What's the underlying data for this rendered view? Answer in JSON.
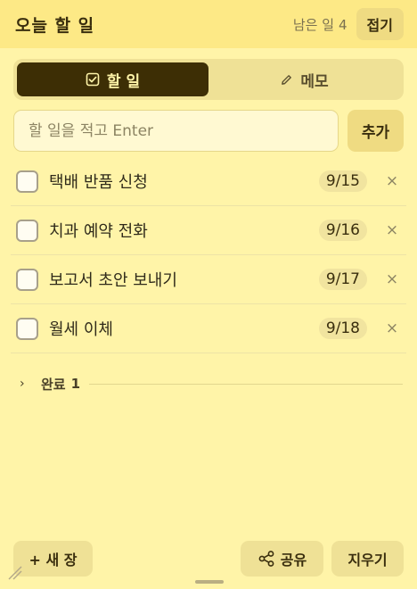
{
  "header": {
    "title": "오늘 할 일",
    "remaining_label": "남은 일",
    "remaining_count": "4",
    "collapse_label": "접기"
  },
  "tabs": [
    {
      "label": "할 일",
      "icon": "checkbox-icon",
      "active": true
    },
    {
      "label": "메모",
      "icon": "pencil-icon",
      "active": false
    }
  ],
  "input": {
    "placeholder": "할 일을 적고 Enter",
    "value": "",
    "add_label": "추가"
  },
  "tasks": [
    {
      "text": "택배 반품 신청",
      "date": "9/15",
      "done": false
    },
    {
      "text": "치과 예약 전화",
      "date": "9/16",
      "done": false
    },
    {
      "text": "보고서 초안 보내기",
      "date": "9/17",
      "done": false
    },
    {
      "text": "월세 이체",
      "date": "9/18",
      "done": false
    }
  ],
  "delete_glyph": "×",
  "completed": {
    "label": "완료",
    "count": "1",
    "chevron": "›"
  },
  "footer": {
    "new_label": "+ 새 장",
    "share_label": "공유",
    "clear_label": "지우기"
  },
  "colors": {
    "background": "#FFF4A8",
    "header": "#FDE986",
    "active_tab": "#3D2E05"
  }
}
